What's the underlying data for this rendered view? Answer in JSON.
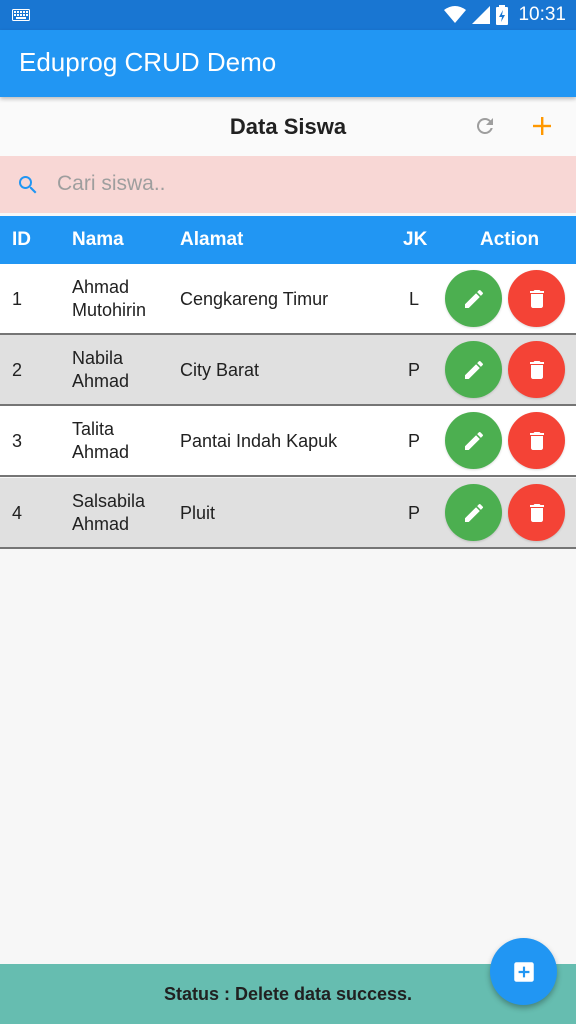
{
  "status_bar": {
    "time": "10:31"
  },
  "app_bar": {
    "title": "Eduprog CRUD Demo"
  },
  "page": {
    "title": "Data Siswa"
  },
  "search": {
    "placeholder": "Cari siswa..",
    "value": ""
  },
  "table": {
    "headers": {
      "id": "ID",
      "nama": "Nama",
      "alamat": "Alamat",
      "jk": "JK",
      "action": "Action"
    },
    "rows": [
      {
        "id": "1",
        "nama_1": "Ahmad",
        "nama_2": "Mutohirin",
        "alamat": "Cengkareng Timur",
        "jk": "L"
      },
      {
        "id": "2",
        "nama_1": "Nabila",
        "nama_2": "Ahmad",
        "alamat": "City Barat",
        "jk": "P"
      },
      {
        "id": "3",
        "nama_1": "Talita",
        "nama_2": "Ahmad",
        "alamat": "Pantai Indah Kapuk",
        "jk": "P"
      },
      {
        "id": "4",
        "nama_1": "Salsabila",
        "nama_2": "Ahmad",
        "alamat": "Pluit",
        "jk": "P"
      }
    ]
  },
  "footer": {
    "status": "Status : Delete data success."
  },
  "icons": {
    "keyboard": "keyboard-icon",
    "wifi": "wifi-icon",
    "signal": "signal-icon",
    "battery": "battery-icon",
    "refresh": "refresh-icon",
    "add": "plus-icon",
    "search": "search-icon",
    "edit": "pencil-icon",
    "delete": "trash-icon",
    "fab": "add-box-icon"
  },
  "colors": {
    "primary": "#2196f3",
    "status_bar": "#1976d2",
    "accent": "#ff9800",
    "edit": "#4caf50",
    "delete": "#f44336",
    "search_bg": "#f8d7d5",
    "footer_bg": "#66bdb0"
  }
}
